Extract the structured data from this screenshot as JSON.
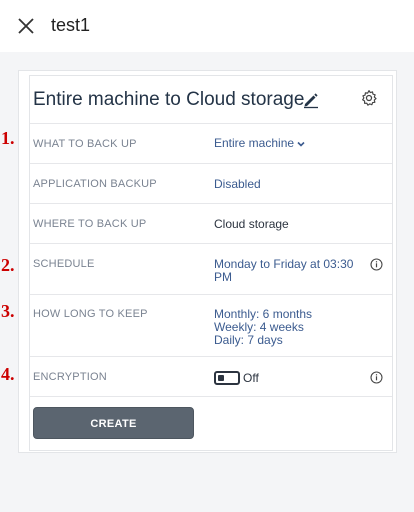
{
  "window": {
    "title": "test1"
  },
  "plan": {
    "name": "Entire machine to Cloud storage"
  },
  "rows": [
    {
      "marker": "1.",
      "label": "WHAT TO BACK UP",
      "value": "Entire machine"
    },
    {
      "label": "APPLICATION BACKUP",
      "value": "Disabled"
    },
    {
      "label": "WHERE TO BACK UP",
      "value": "Cloud storage"
    },
    {
      "marker": "2.",
      "label": "SCHEDULE",
      "value_line1": "Monday to Friday at 03:30",
      "value_line2": "PM"
    },
    {
      "marker": "3.",
      "label": "HOW LONG TO KEEP",
      "value_line1": "Monthly: 6 months",
      "value_line2": "Weekly: 4 weeks",
      "value_line3": "Daily: 7 days"
    },
    {
      "marker": "4.",
      "label": "ENCRYPTION",
      "value": "Off"
    }
  ],
  "actions": {
    "create_label": "CREATE"
  },
  "icons": {
    "close": "close-icon",
    "edit": "pencil-icon",
    "settings": "gear-icon",
    "info": "info-icon",
    "dropdown": "chevron-down-icon"
  },
  "colors": {
    "accent_link": "#3b5b8f",
    "annotation_red": "#cc0000",
    "button_bg": "#5b6570"
  }
}
